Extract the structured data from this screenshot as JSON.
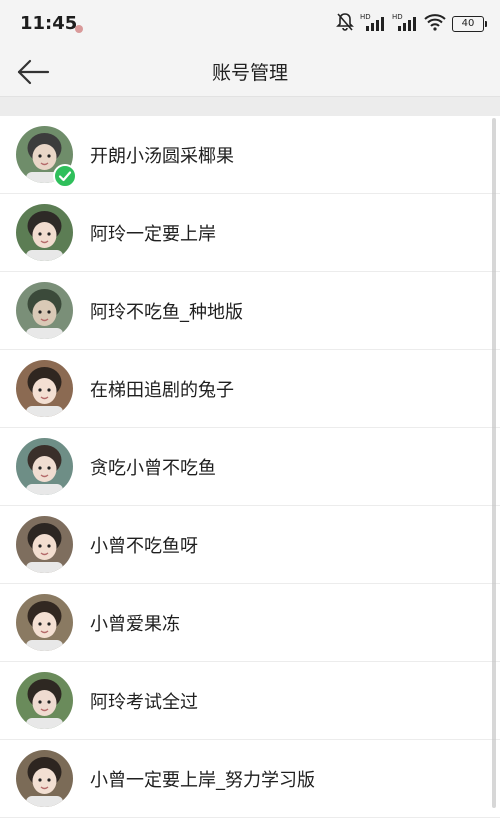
{
  "status_bar": {
    "time": "11:45",
    "battery": "40",
    "icons": [
      "notification-app-icon",
      "mute-bell-icon",
      "hd-signal-icon",
      "hd-signal-icon",
      "wifi-icon",
      "battery-icon"
    ]
  },
  "nav": {
    "back_icon": "arrow-left-icon",
    "title": "账号管理"
  },
  "accounts": [
    {
      "name": "开朗小汤圆采椰果",
      "active": true
    },
    {
      "name": "阿玲一定要上岸",
      "active": false
    },
    {
      "name": "阿玲不吃鱼_种地版",
      "active": false
    },
    {
      "name": "在梯田追剧的兔子",
      "active": false
    },
    {
      "name": "贪吃小曾不吃鱼",
      "active": false
    },
    {
      "name": "小曾不吃鱼呀",
      "active": false
    },
    {
      "name": "小曾爱果冻",
      "active": false
    },
    {
      "name": "阿玲考试全过",
      "active": false
    },
    {
      "name": "小曾一定要上岸_努力学习版",
      "active": false
    }
  ],
  "colors": {
    "active_check": "#2fbf5b",
    "header_bg": "#f4f4f4"
  }
}
